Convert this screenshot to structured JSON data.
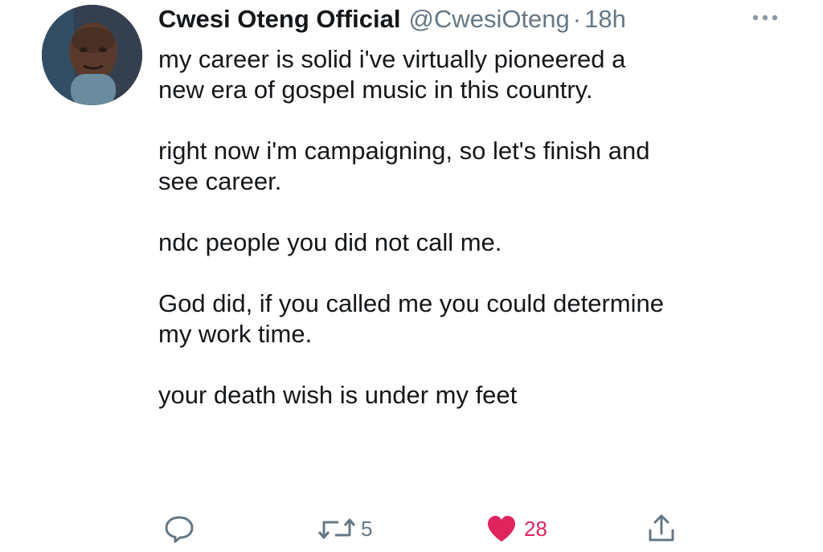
{
  "author": {
    "display_name": "Cwesi Oteng Official",
    "handle": "@CwesiOteng",
    "separator": "·",
    "time": "18h"
  },
  "tweet": {
    "paragraphs": [
      "my career is solid i've virtually pioneered a\nnew era of gospel music in this country.",
      "right now i'm campaigning, so let's finish and\nsee career.",
      "ndc people you did not call me.",
      "God did, if you called me you could determine\nmy work time.",
      "your death wish is under my feet"
    ]
  },
  "actions": {
    "reply_icon": "speech-bubble-icon",
    "retweet_icon": "retweet-arrows-icon",
    "retweet_count": "5",
    "like_icon": "heart-icon",
    "like_count": "28",
    "like_color": "#e0245e",
    "share_icon": "share-upload-icon"
  },
  "colors": {
    "text": "#14171a",
    "secondary": "#657786",
    "like_active": "#e0245e"
  }
}
